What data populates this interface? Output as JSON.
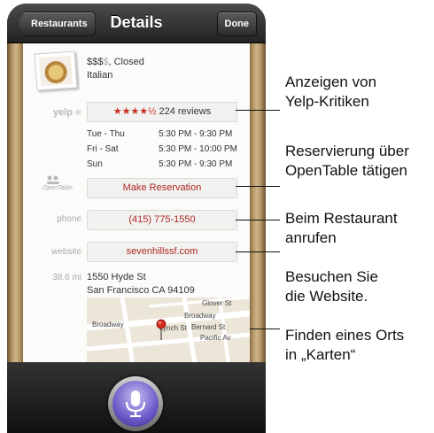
{
  "navbar": {
    "back_label": "Restaurants",
    "title": "Details",
    "done_label": "Done"
  },
  "restaurant": {
    "price_active": "$$$",
    "price_inactive": "$",
    "status": ", Closed",
    "cuisine": "Italian"
  },
  "yelp": {
    "label": "yelp",
    "stars": "★★★★½",
    "reviews": "224 reviews"
  },
  "hours": [
    {
      "day": "Tue - Thu",
      "time": "5:30 PM -  9:30 PM"
    },
    {
      "day": "Fri - Sat",
      "time": "5:30 PM - 10:00 PM"
    },
    {
      "day": "Sun",
      "time": "5:30 PM -  9:30 PM"
    }
  ],
  "opentable": {
    "label": "OpenTable",
    "button": "Make Reservation"
  },
  "phone": {
    "label": "phone",
    "value": "(415) 775-1550"
  },
  "website": {
    "label": "website",
    "value": "sevenhillssf.com"
  },
  "address": {
    "distance": "38.6 mi",
    "line1": "1550 Hyde St",
    "line2": "San Francisco CA 94109"
  },
  "map": {
    "streets": [
      "Glover St",
      "Broadway",
      "Broadway",
      "Bernard St",
      "Lynch St",
      "Pacific Av"
    ]
  },
  "callouts": [
    {
      "line1": "Anzeigen von",
      "line2": "Yelp-Kritiken"
    },
    {
      "line1": "Reservierung über",
      "line2": "OpenTable tätigen"
    },
    {
      "line1": "Beim Restaurant",
      "line2": "anrufen"
    },
    {
      "line1": "Besuchen Sie",
      "line2": "die Website."
    },
    {
      "line1": "Finden eines Orts",
      "line2": "in „Karten“"
    }
  ],
  "icons": {
    "mic": "microphone-icon",
    "food": "food-photo",
    "pin": "map-pin-icon"
  },
  "colors": {
    "accent_red": "#b02a25",
    "mic_purple": "#6b58c8"
  }
}
